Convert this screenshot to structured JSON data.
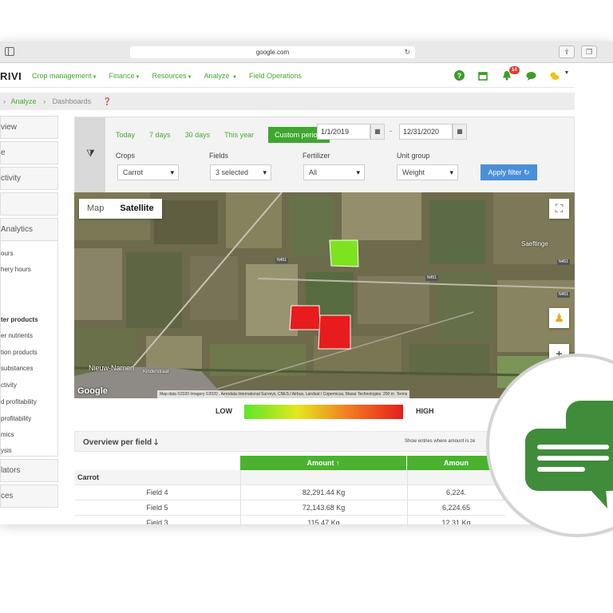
{
  "browser": {
    "url": "google.com"
  },
  "app": {
    "brand": "RIVI",
    "menu": [
      "Crop management",
      "Finance",
      "Resources",
      "Analyze",
      "Field Operations"
    ],
    "menu_has_caret": [
      true,
      true,
      true,
      true,
      false
    ],
    "notifications_count": "14"
  },
  "breadcrumb": {
    "items": [
      "Analyze",
      "Dashboards"
    ]
  },
  "sidebar": {
    "items": [
      "view",
      "e",
      "ctivity"
    ],
    "blank_item": "",
    "section": "Analytics",
    "sub_items": [
      "ours",
      "hery hours",
      "ter products",
      "er nutrients",
      "tion products",
      "substances",
      "ctivity",
      "d profitability",
      " profitability",
      "mics",
      "ysis"
    ],
    "bottom_items": [
      "lators",
      "ces"
    ]
  },
  "filters": {
    "quick_dates": [
      "Today",
      "7 days",
      "30 days",
      "This year"
    ],
    "custom_label": "Custom period:",
    "date_from": "1/1/2019",
    "date_sep": "-",
    "date_to": "12/31/2020",
    "crops": {
      "label": "Crops",
      "value": "Carrot"
    },
    "fields": {
      "label": "Fields",
      "value": "3 selected"
    },
    "fertilizer": {
      "label": "Fertilizer",
      "value": "All"
    },
    "unit_group": {
      "label": "Unit group",
      "value": "Weight"
    },
    "apply_label": "Apply filter"
  },
  "map": {
    "tabs": [
      "Map",
      "Satellite"
    ],
    "active_tab": "Satellite",
    "places": [
      "Saeftinge",
      "Nieuw-Namen",
      "Kinderstraat"
    ],
    "roads": [
      "N451",
      "N451",
      "N451",
      "N451"
    ],
    "attribution": "Map data ©2020 Imagery ©2020 , Aerodata International Surveys, CNES / Airbus, Landsat / Copernicus, Maxar Technologies",
    "scale": "200 m",
    "terms": "Terms",
    "logo": "Google",
    "colors": {
      "field_low": "#7ee31f",
      "field_high": "#e81c1c"
    }
  },
  "legend": {
    "low": "LOW",
    "high": "HIGH"
  },
  "overview": {
    "title": "Overview per field",
    "show_entries": "Show entries where amount is ze",
    "columns": [
      "Amount ↑",
      "Amoun"
    ],
    "group": "Carrot",
    "rows": [
      {
        "field": "Field 4",
        "amount": "82,291.44 Kg",
        "amount2": "6,224."
      },
      {
        "field": "Field 5",
        "amount": "72,143.68 Kg",
        "amount2": "6,224.65"
      },
      {
        "field": "Field 3",
        "amount": "115.47 Kg",
        "amount2": "12.31 Kg"
      }
    ]
  }
}
